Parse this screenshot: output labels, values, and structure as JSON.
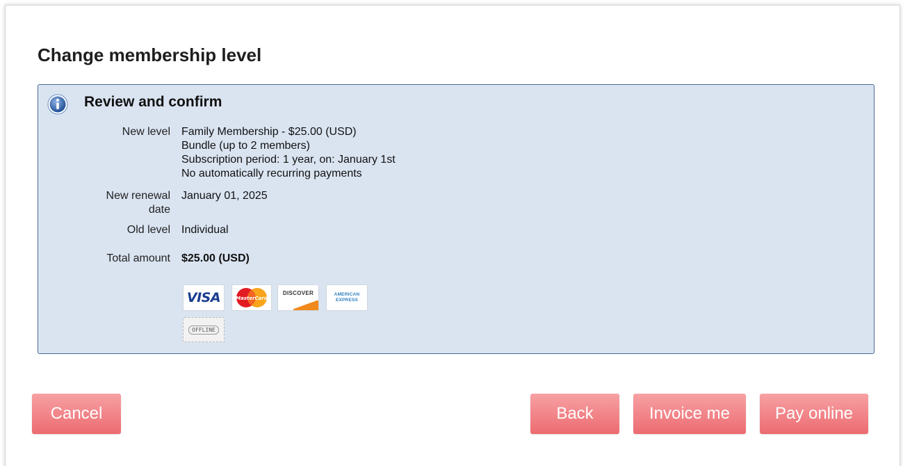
{
  "page": {
    "title": "Change membership level"
  },
  "review": {
    "title": "Review and confirm",
    "icon": "info-icon",
    "new_level": {
      "label": "New level",
      "lines": [
        "Family Membership - $25.00 (USD)",
        "Bundle (up to 2 members)",
        "Subscription period: 1 year, on: January 1st",
        "No automatically recurring payments"
      ]
    },
    "renewal": {
      "label_line1": "New renewal",
      "label_line2": "date",
      "value": "January 01, 2025"
    },
    "old_level": {
      "label": "Old level",
      "value": "Individual"
    },
    "total": {
      "label": "Total amount",
      "value": "$25.00 (USD)"
    },
    "payment_logos": {
      "visa": "VISA",
      "mastercard": "MasterCard",
      "discover": "DISCOVER",
      "amex_line1": "AMERICAN",
      "amex_line2": "EXPRESS",
      "offline": "OFFLINE"
    }
  },
  "buttons": {
    "cancel": "Cancel",
    "back": "Back",
    "invoice": "Invoice me",
    "pay_online": "Pay online"
  },
  "colors": {
    "box_background": "#dae4f1",
    "box_border": "#4a6a96",
    "button_top": "#f7a1a4",
    "button_bottom": "#ec6b70"
  }
}
